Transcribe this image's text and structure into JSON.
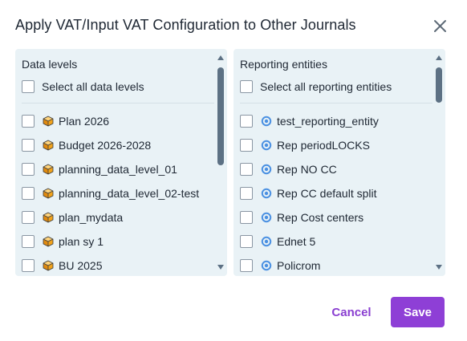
{
  "dialog": {
    "title": "Apply VAT/Input VAT Configuration to Other Journals",
    "close_icon": "close-icon"
  },
  "data_levels": {
    "heading": "Data levels",
    "select_all_label": "Select all data levels",
    "item_icon": "cube-icon",
    "items": [
      {
        "label": "Plan 2026"
      },
      {
        "label": "Budget 2026-2028"
      },
      {
        "label": "planning_data_level_01"
      },
      {
        "label": "planning_data_level_02-test"
      },
      {
        "label": "plan_mydata"
      },
      {
        "label": "plan sy 1"
      },
      {
        "label": "BU 2025"
      }
    ]
  },
  "reporting_entities": {
    "heading": "Reporting entities",
    "select_all_label": "Select all reporting entities",
    "item_icon": "target-circle-icon",
    "items": [
      {
        "label": "test_reporting_entity"
      },
      {
        "label": "Rep periodLOCKS"
      },
      {
        "label": "Rep NO CC"
      },
      {
        "label": "Rep CC default split"
      },
      {
        "label": "Rep Cost centers"
      },
      {
        "label": "Ednet 5"
      },
      {
        "label": "Policrom"
      }
    ]
  },
  "footer": {
    "cancel_label": "Cancel",
    "save_label": "Save"
  },
  "colors": {
    "accent": "#8e3fd6",
    "panel_bg": "#e9f2f6",
    "scrollbar": "#5d7184",
    "cube_orange": "#f2a31b",
    "target_blue": "#4a90e2"
  }
}
